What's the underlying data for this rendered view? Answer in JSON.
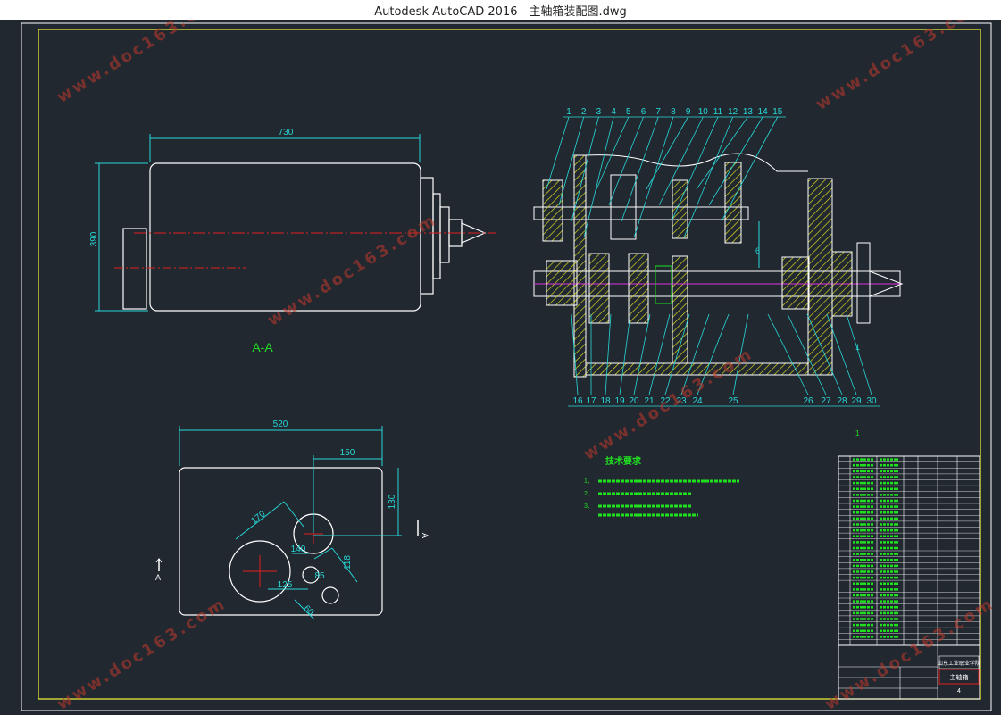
{
  "window": {
    "title": "Autodesk AutoCAD 2016　主轴箱装配图.dwg"
  },
  "watermark": "www.doc163.com",
  "colors": {
    "background": "#212830",
    "frame": "#e8e838",
    "outline": "#ffffff",
    "dimension": "#28d8d8",
    "centerline": "#e02020",
    "hatch": "#d8d820",
    "green": "#20e020",
    "magenta": "#e030e0",
    "watermark": "#c0392b"
  },
  "left_view": {
    "width_dim": "730",
    "height_dim": "390",
    "section_label": "A-A"
  },
  "bottom_view": {
    "dims": [
      "520",
      "150",
      "130",
      "170",
      "140",
      "125",
      "118",
      "85",
      "66"
    ],
    "section_marks": [
      "A",
      "A"
    ]
  },
  "assembly": {
    "top_callouts": [
      "1",
      "2",
      "3",
      "4",
      "5",
      "6",
      "7",
      "8",
      "9",
      "10",
      "11",
      "12",
      "13",
      "14",
      "15"
    ],
    "bottom_callouts": [
      "16",
      "17",
      "18",
      "19",
      "20",
      "21",
      "22",
      "23",
      "24",
      "25",
      "26",
      "27",
      "28",
      "29",
      "30"
    ],
    "center_dim": "6",
    "side_note": "1"
  },
  "tech_notes": {
    "title": "技术要求",
    "items": [
      "1、",
      "2、",
      "3、"
    ]
  },
  "title_block": {
    "page_num": "1",
    "line1": "山东工业职业学院",
    "line2": "主轴箱",
    "sheet": "4"
  }
}
